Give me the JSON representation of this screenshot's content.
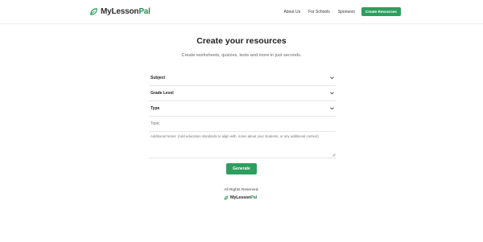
{
  "header": {
    "logo_part1": "MyLesson",
    "logo_part2": "Pal",
    "nav": {
      "about": "About Us",
      "schools": "For Schools",
      "sponsors": "Sponsors",
      "cta": "Create Resources"
    }
  },
  "main": {
    "title": "Create your resources",
    "subtitle": "Create worksheets, quizzes, tests and more in just seconds.",
    "fields": {
      "subject": "Subject",
      "grade_level": "Grade Level",
      "type": "Type",
      "topic_placeholder": "Topic",
      "notes_placeholder": "Additional Notes: (Add education standards to align with, notes about your students, or any additional context)"
    },
    "generate_label": "Generate"
  },
  "footer": {
    "rights": "All Rights Reserved.",
    "logo_part1": "MyLesson",
    "logo_part2": "Pal"
  },
  "colors": {
    "brand_green": "#2e9e5e",
    "text_dark": "#222222"
  },
  "icons": [
    "leaf-logo-icon",
    "chevron-down-icon",
    "resize-handle-icon"
  ]
}
